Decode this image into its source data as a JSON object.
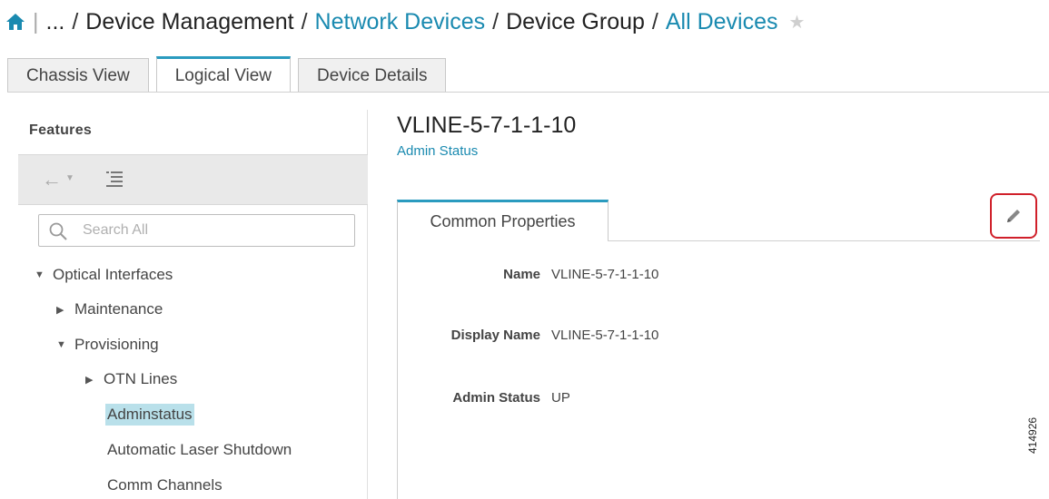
{
  "breadcrumb": {
    "ellipsis": "...",
    "items": [
      "Device Management",
      "Network Devices",
      "Device Group",
      "All Devices"
    ]
  },
  "tabs": [
    "Chassis View",
    "Logical View",
    "Device Details"
  ],
  "features": {
    "title": "Features",
    "search_placeholder": "Search All",
    "tree": [
      {
        "label": "Optical Interfaces",
        "expanded": true
      },
      {
        "label": "Maintenance",
        "expanded": false
      },
      {
        "label": "Provisioning",
        "expanded": true
      },
      {
        "label": "OTN Lines",
        "expanded": false
      },
      {
        "label": "Adminstatus",
        "selected": true
      },
      {
        "label": "Automatic Laser Shutdown"
      },
      {
        "label": "Comm Channels"
      }
    ]
  },
  "content": {
    "title": "VLINE-5-7-1-1-10",
    "subtitle": "Admin Status",
    "tab_label": "Common Properties",
    "properties": [
      {
        "label": "Name",
        "value": "VLINE-5-7-1-1-10"
      },
      {
        "label": "Display Name",
        "value": "VLINE-5-7-1-1-10"
      },
      {
        "label": "Admin Status",
        "value": "UP"
      }
    ]
  },
  "figure_id": "414926",
  "colors": {
    "link": "#1a8ab0",
    "accent": "#2a9bbf",
    "highlight": "#d0202a",
    "selected_bg": "#b9e0ea"
  }
}
